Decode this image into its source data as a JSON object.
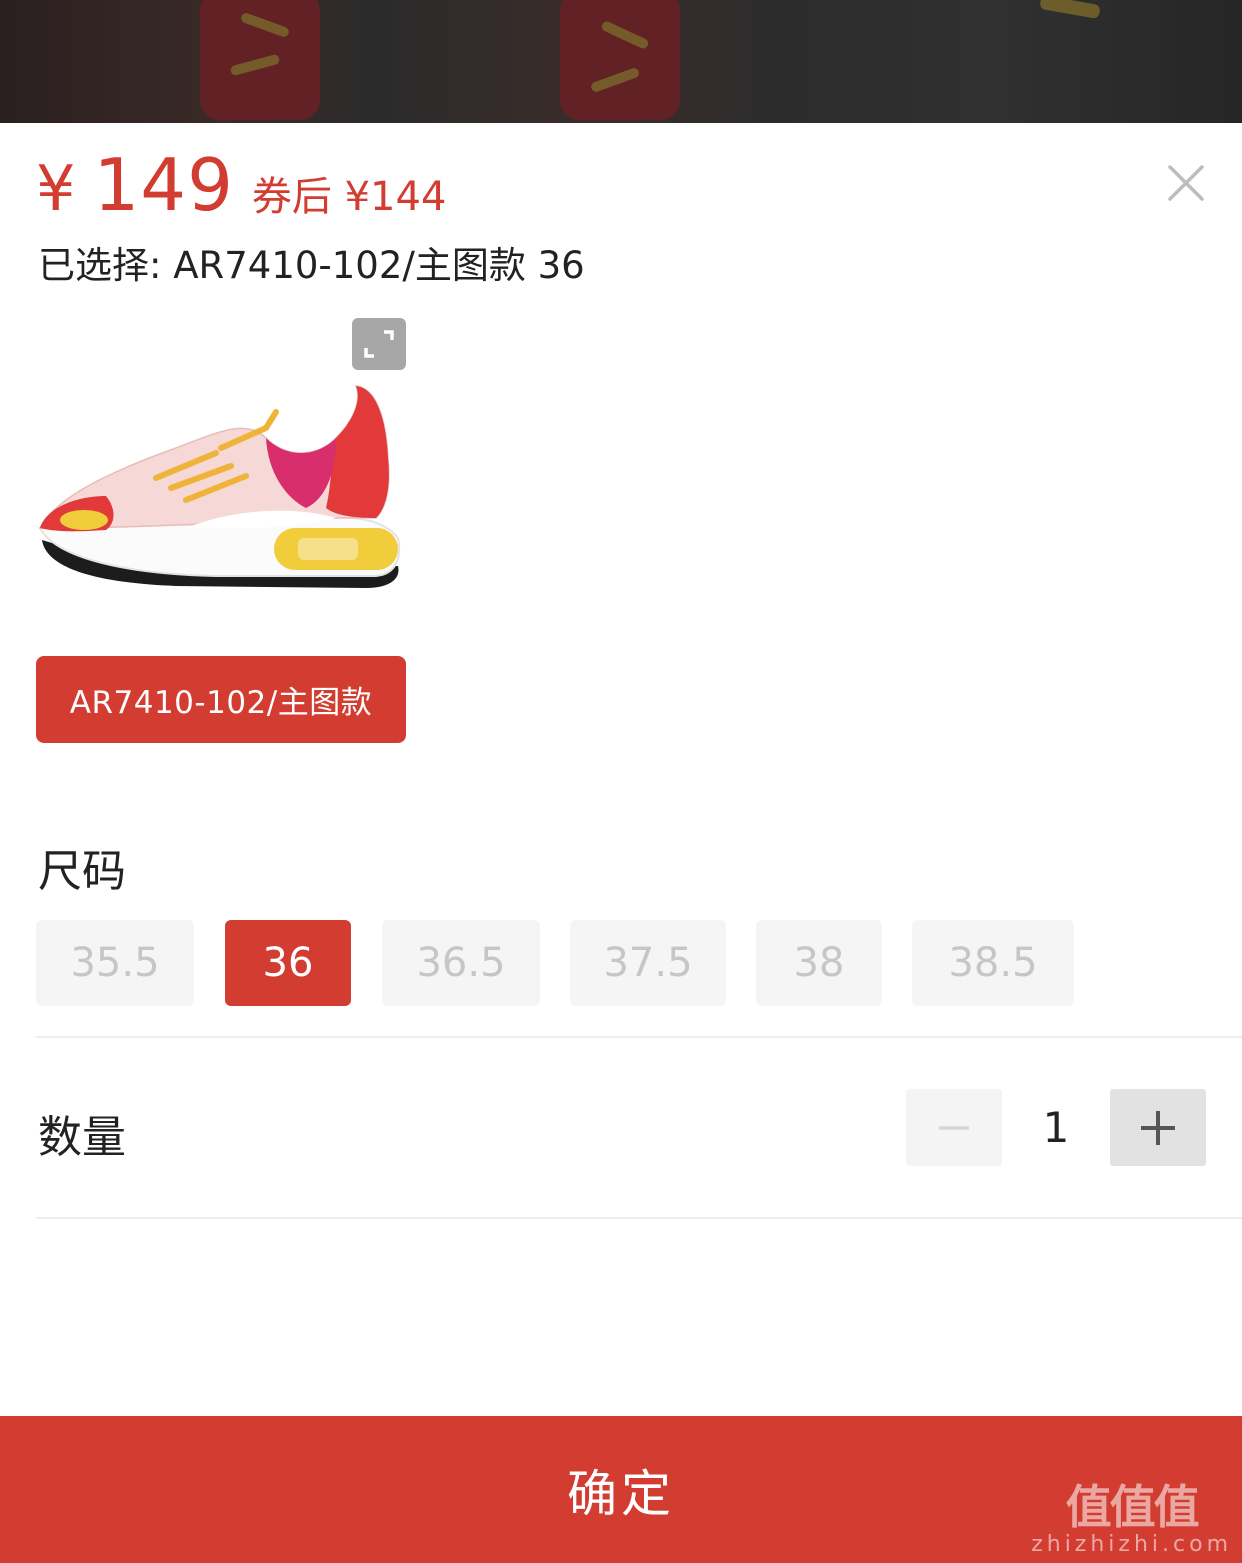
{
  "price": {
    "symbol": "¥",
    "value": "149",
    "coupon_text": "券后 ¥144"
  },
  "selected_text": "已选择: AR7410-102/主图款 36",
  "variant": {
    "label": "AR7410-102/主图款"
  },
  "size": {
    "label": "尺码",
    "options": [
      "35.5",
      "36",
      "36.5",
      "37.5",
      "38",
      "38.5"
    ],
    "selected": "36"
  },
  "quantity": {
    "label": "数量",
    "value": "1"
  },
  "confirm_label": "确定",
  "watermark": {
    "brand": "值值值",
    "url": "zhizhizhi.com"
  },
  "colors": {
    "accent": "#d23c31",
    "disabled_text": "#c6c6c6",
    "chip_bg": "#f5f5f5"
  },
  "icons": {
    "close": "close-icon",
    "expand": "expand-icon",
    "minus": "minus-icon",
    "plus": "plus-icon"
  }
}
